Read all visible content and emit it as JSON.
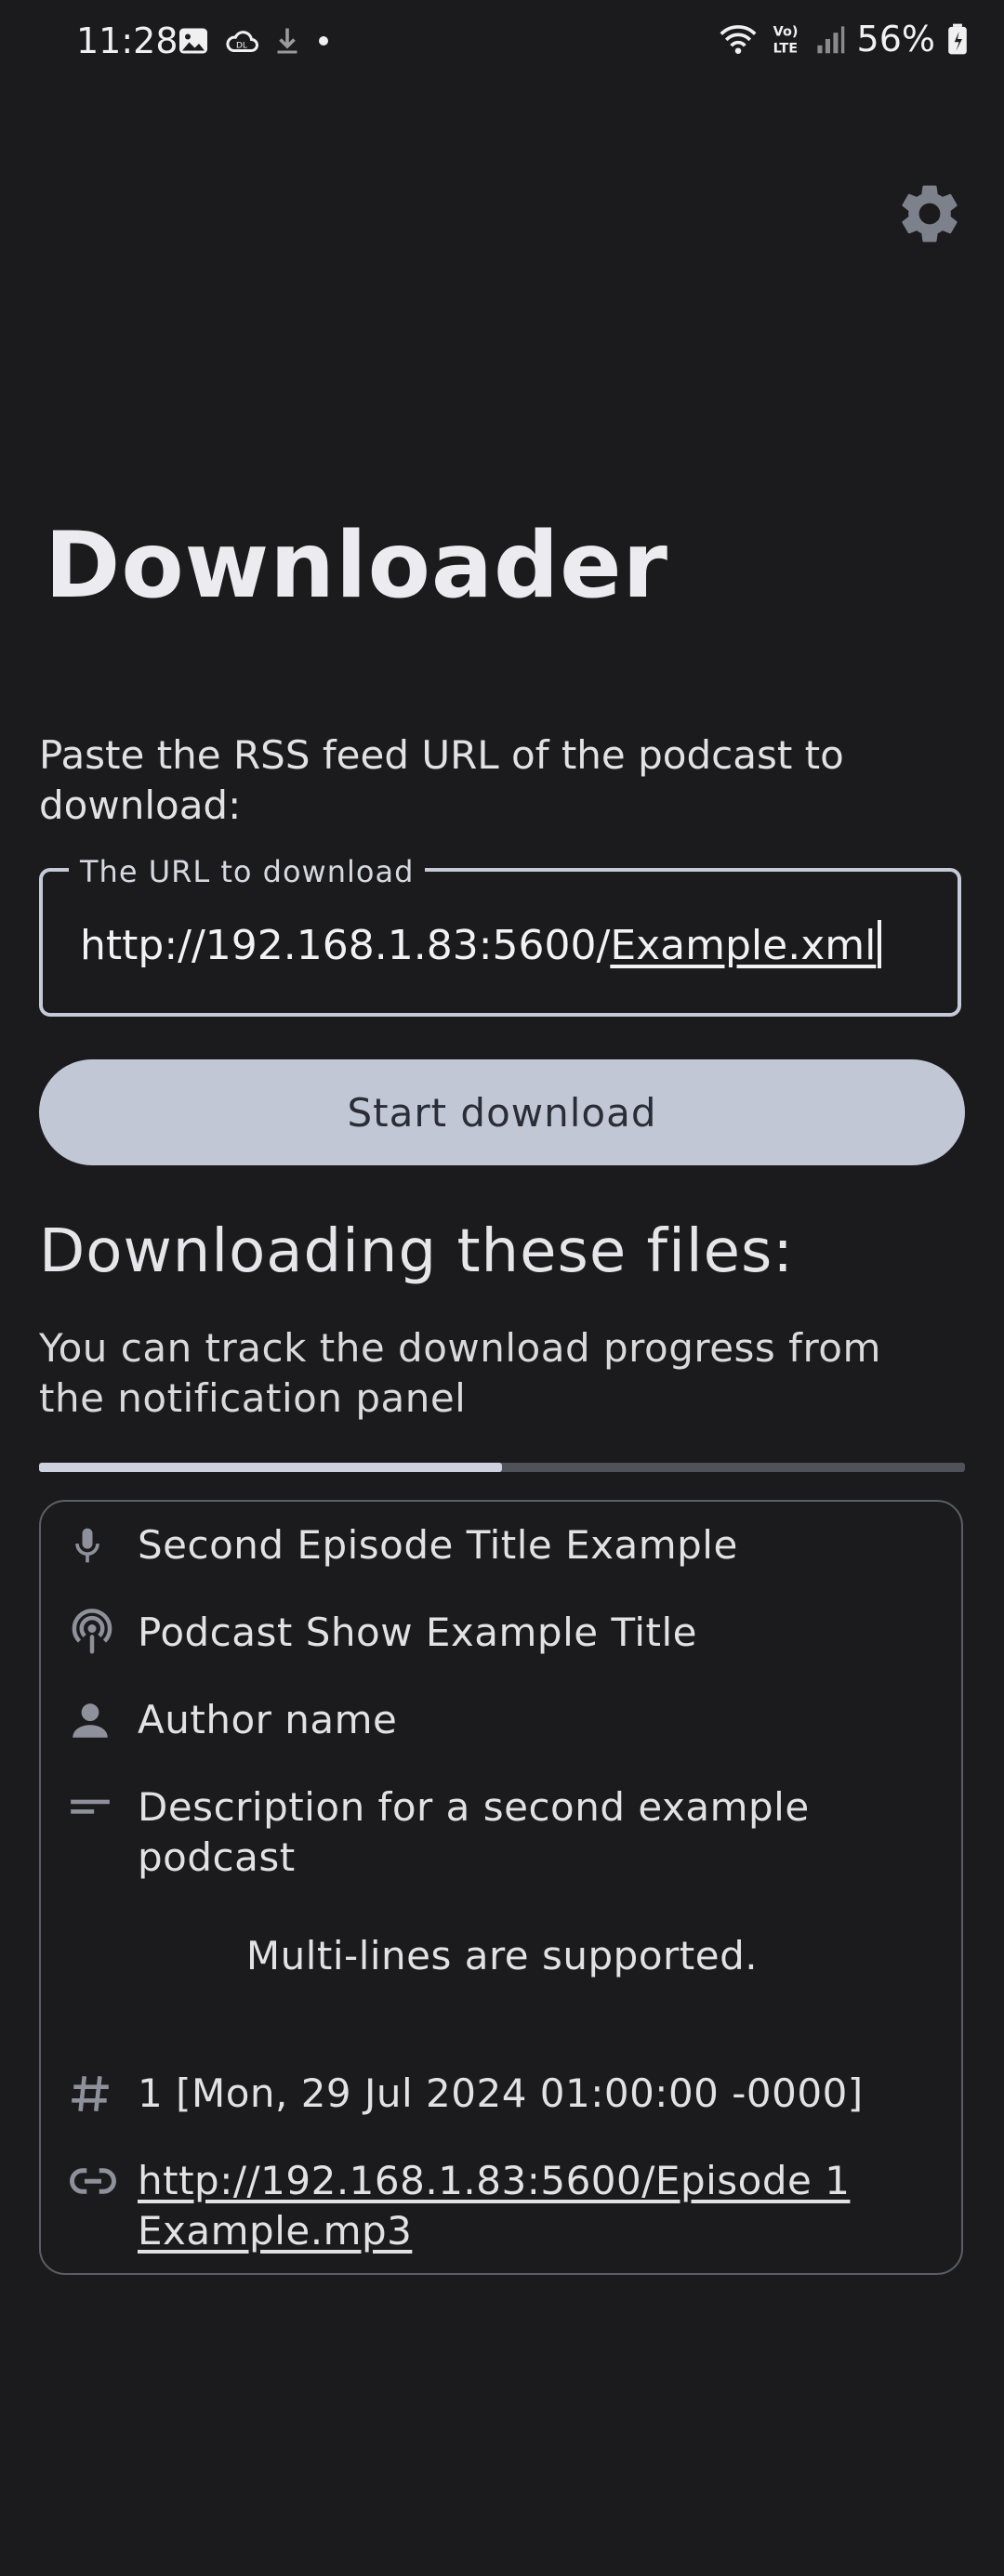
{
  "status_bar": {
    "time": "11:28",
    "battery": "56%",
    "left_icons": [
      "image-icon",
      "cloud-icon",
      "download-icon",
      "dot-icon"
    ],
    "right_icons": [
      "wifi-icon",
      "volte-icon",
      "signal-icon",
      "battery-icon"
    ]
  },
  "app": {
    "title": "Downloader",
    "settings_icon": "gear-icon"
  },
  "form": {
    "prompt": "Paste the RSS feed URL of the podcast to download:",
    "url_label": "The URL to download",
    "url_value_prefix": "http://192.168.1.83:5600/",
    "url_value_suffix": "Example.xml",
    "start_button": "Start download"
  },
  "downloads": {
    "heading": "Downloading these files:",
    "hint": "You can track the download progress from the notification panel",
    "progress": 0.5,
    "episode": {
      "title": "Second Episode Title Example",
      "show": "Podcast Show Example Title",
      "author": "Author name",
      "description": "Description for a second example podcast",
      "description_extra": "Multi-lines are supported.",
      "number_date": "1 [Mon, 29 Jul 2024 01:00:00 -0000]",
      "url": "http://192.168.1.83:5600/Episode 1 Example.mp3"
    }
  },
  "colors": {
    "background": "#1b1b1d",
    "accent": "#c2c7d6",
    "icon": "#8e919b"
  }
}
